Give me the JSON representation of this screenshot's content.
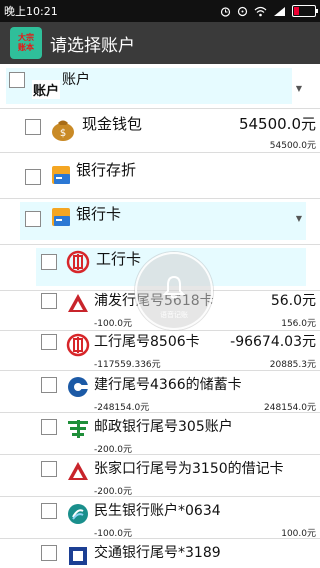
{
  "status_bar": {
    "time": "晚上10:21"
  },
  "app": {
    "icon_text_1": "大宗",
    "icon_text_2": "账本",
    "title": "请选择账户"
  },
  "header": {
    "tag": "账户",
    "label": "账户"
  },
  "floating": {
    "label": "语音记账"
  },
  "items": [
    {
      "name": "现金钱包",
      "amount": "54500.0元",
      "sub_right": "54500.0元"
    },
    {
      "name": "银行存折"
    },
    {
      "name": "银行卡"
    },
    {
      "name": "工行卡"
    },
    {
      "name": "浦发行尾号5618卡",
      "amount": "56.0元",
      "sub_left": "-100.0元",
      "sub_right": "156.0元"
    },
    {
      "name": "工行尾号8506卡",
      "amount": "-96674.03元",
      "sub_left": "-117559.336元",
      "sub_right": "20885.3元"
    },
    {
      "name": "建行尾号4366的储蓄卡",
      "sub_left": "-248154.0元",
      "sub_right": "248154.0元"
    },
    {
      "name": "邮政银行尾号305账户",
      "sub_left": "-200.0元"
    },
    {
      "name": "张家口行尾号为3150的借记卡",
      "sub_left": "-200.0元"
    },
    {
      "name": "民生银行账户*0634",
      "sub_left": "-100.0元",
      "sub_right": "100.0元"
    },
    {
      "name": "交通银行尾号*3189"
    }
  ],
  "colors": {
    "highlight": "#e6fbff",
    "titlebar": "#3a3a3a",
    "icbc_red": "#d7262a",
    "ccb_blue": "#1c5aa6",
    "psbc_green": "#1f8f3a",
    "cmbc_teal": "#1a8f8c"
  }
}
